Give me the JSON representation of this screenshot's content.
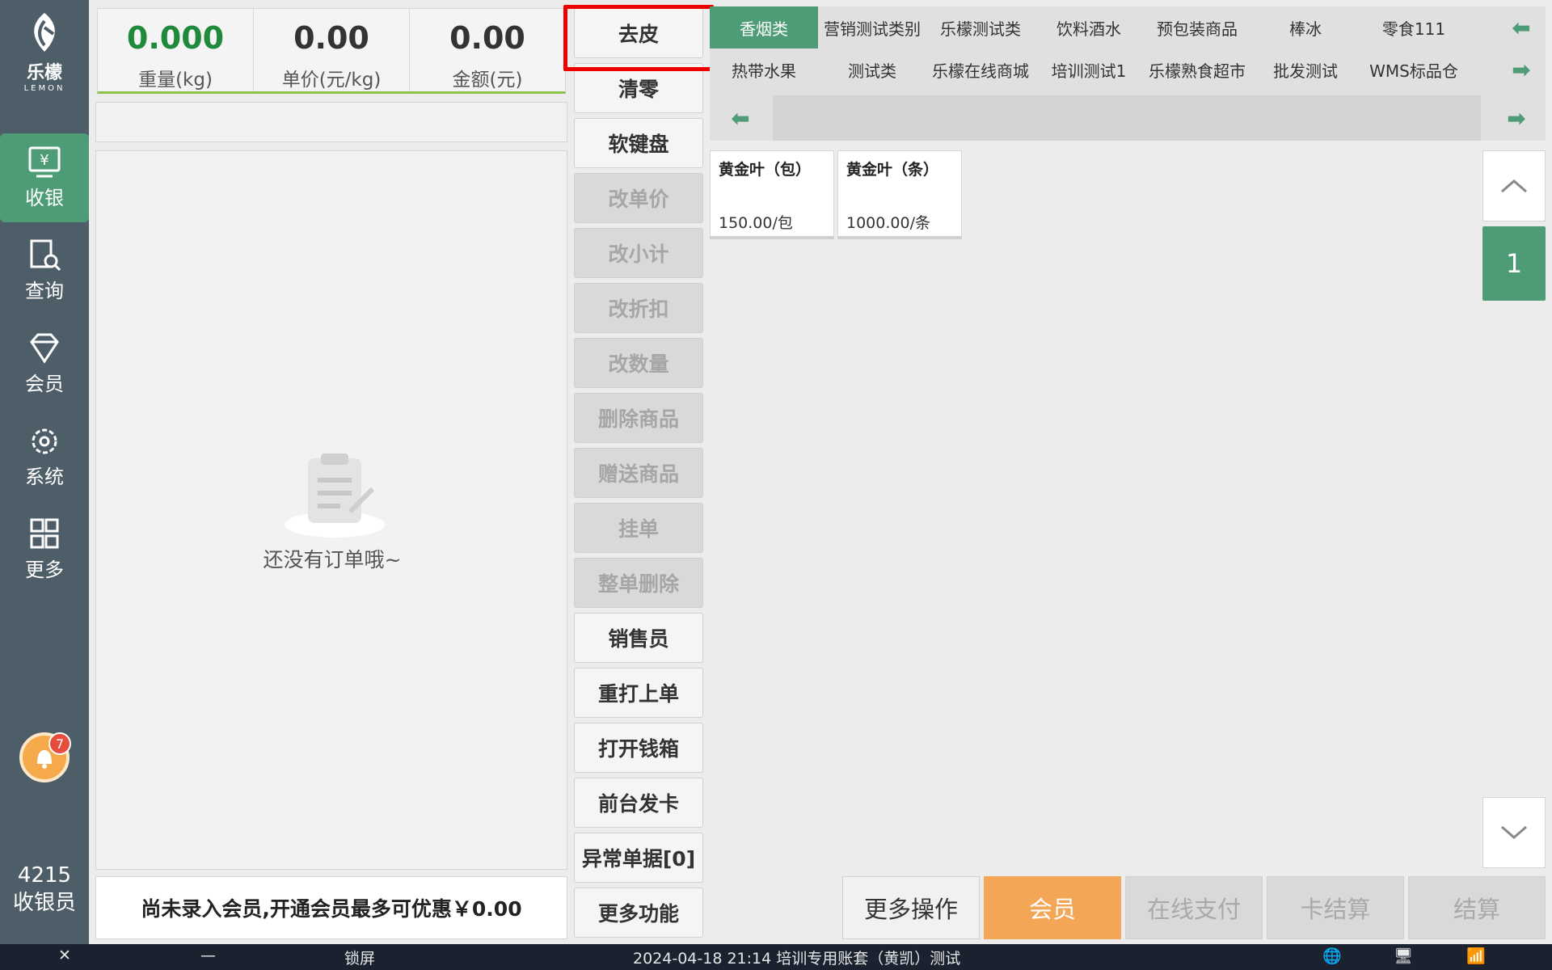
{
  "sidebar": {
    "brand": "乐檬",
    "brand_sub": "LEMON",
    "items": [
      {
        "label": "收银",
        "icon": "cash-register-icon"
      },
      {
        "label": "查询",
        "icon": "search-document-icon"
      },
      {
        "label": "会员",
        "icon": "diamond-icon"
      },
      {
        "label": "系统",
        "icon": "gear-icon"
      },
      {
        "label": "更多",
        "icon": "grid-icon"
      }
    ],
    "notification_count": "7",
    "cashier_id": "4215",
    "cashier_role": "收银员"
  },
  "scale": {
    "weight_value": "0.000",
    "weight_label": "重量(kg)",
    "unit_price_value": "0.00",
    "unit_price_label": "单价(元/kg)",
    "amount_value": "0.00",
    "amount_label": "金额(元)"
  },
  "order": {
    "empty_text": "还没有订单哦~",
    "member_promo": "尚未录入会员,开通会员最多可优惠￥0.00"
  },
  "functions": [
    {
      "label": "去皮",
      "enabled": true
    },
    {
      "label": "清零",
      "enabled": true
    },
    {
      "label": "软键盘",
      "enabled": true
    },
    {
      "label": "改单价",
      "enabled": false
    },
    {
      "label": "改小计",
      "enabled": false
    },
    {
      "label": "改折扣",
      "enabled": false
    },
    {
      "label": "改数量",
      "enabled": false
    },
    {
      "label": "删除商品",
      "enabled": false
    },
    {
      "label": "赠送商品",
      "enabled": false
    },
    {
      "label": "挂单",
      "enabled": false
    },
    {
      "label": "整单删除",
      "enabled": false
    },
    {
      "label": "销售员",
      "enabled": true
    },
    {
      "label": "重打上单",
      "enabled": true
    },
    {
      "label": "打开钱箱",
      "enabled": true
    },
    {
      "label": "前台发卡",
      "enabled": true
    },
    {
      "label": "异常单据[0]",
      "enabled": true
    },
    {
      "label": "更多功能",
      "enabled": true
    }
  ],
  "categories": {
    "row1": [
      "香烟类",
      "营销测试类别",
      "乐檬测试类",
      "饮料酒水",
      "预包装商品",
      "棒冰",
      "零食111"
    ],
    "row2": [
      "热带水果",
      "测试类",
      "乐檬在线商城",
      "培训测试1",
      "乐檬熟食超市",
      "批发测试",
      "WMS标品仓"
    ],
    "active": "香烟类"
  },
  "products": [
    {
      "name": "黄金叶（包）",
      "price": "150.00/包"
    },
    {
      "name": "黄金叶（条）",
      "price": "1000.00/条"
    }
  ],
  "pager": {
    "current_page": "1"
  },
  "actions": [
    {
      "label": "更多操作",
      "style": "more"
    },
    {
      "label": "会员",
      "style": "member"
    },
    {
      "label": "在线支付",
      "style": "disabled"
    },
    {
      "label": "卡结算",
      "style": "disabled"
    },
    {
      "label": "结算",
      "style": "disabled"
    }
  ],
  "taskbar": {
    "lock_label": "锁屏",
    "status_text": "2024-04-18 21:14  培训专用账套（黄凯）测试"
  },
  "colors": {
    "accent": "#4e9c76",
    "member": "#f2a656",
    "highlight": "#ee0000",
    "sidebar": "#4e5e69"
  }
}
